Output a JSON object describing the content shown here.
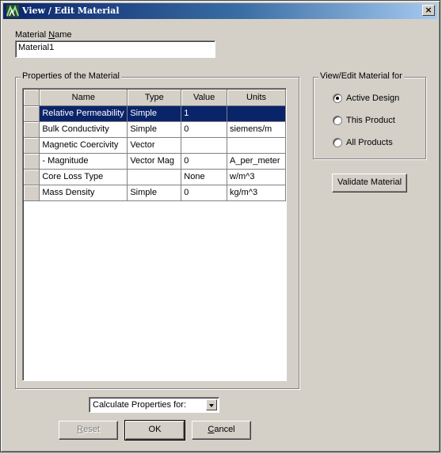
{
  "window": {
    "title": "View / Edit Material",
    "close_glyph": "×"
  },
  "material_name": {
    "label_prefix": "Material ",
    "label_mnemonic": "N",
    "label_suffix": "ame",
    "value": "Material1"
  },
  "properties": {
    "caption": "Properties of the Material",
    "columns": [
      "Name",
      "Type",
      "Value",
      "Units"
    ],
    "rows": [
      {
        "name": "Relative Permeability",
        "type": "Simple",
        "value": "1",
        "units": ""
      },
      {
        "name": "Bulk Conductivity",
        "type": "Simple",
        "value": "0",
        "units": "siemens/m"
      },
      {
        "name": "Magnetic Coercivity",
        "type": "Vector",
        "value": "",
        "units": ""
      },
      {
        "name": "- Magnitude",
        "type": "Vector Mag",
        "value": "0",
        "units": "A_per_meter"
      },
      {
        "name": "Core Loss Type",
        "type": "",
        "value": "None",
        "units": "w/m^3"
      },
      {
        "name": "Mass Density",
        "type": "Simple",
        "value": "0",
        "units": "kg/m^3"
      }
    ],
    "selected_row": 0
  },
  "view_edit_for": {
    "caption": "View/Edit Material for",
    "options": [
      "Active Design",
      "This Product",
      "All Products"
    ],
    "selected": "Active Design"
  },
  "buttons": {
    "validate": "Validate Material",
    "reset_mnemonic": "R",
    "reset_rest": "eset",
    "ok": "OK",
    "cancel_mnemonic": "C",
    "cancel_rest": "ancel"
  },
  "calculate": {
    "selected": "Calculate Properties for:"
  },
  "icons": {
    "title": "app-logo-icon",
    "close": "close-icon",
    "dropdown": "chevron-down-icon"
  },
  "colors": {
    "selection": "#0a246a",
    "title_start": "#0a246a",
    "title_end": "#a6caf0",
    "face": "#d4d0c8"
  }
}
